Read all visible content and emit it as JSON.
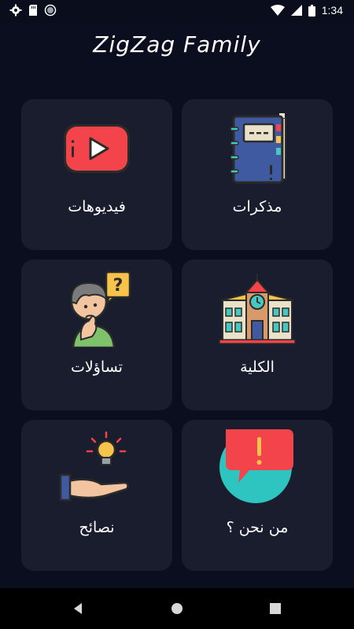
{
  "status_bar": {
    "time": "1:34",
    "left_icons": [
      "gear-icon",
      "sd-card-icon",
      "record-icon"
    ],
    "right_icons": [
      "wifi-icon",
      "signal-icon",
      "battery-icon"
    ]
  },
  "app": {
    "title": "ZigZag Family"
  },
  "cards": [
    {
      "label": "فيديوهات",
      "icon": "youtube-play-icon"
    },
    {
      "label": "مذكرات",
      "icon": "notebook-icon"
    },
    {
      "label": "تساؤلات",
      "icon": "thinking-person-icon"
    },
    {
      "label": "الكلية",
      "icon": "college-building-icon"
    },
    {
      "label": "نصائح",
      "icon": "hand-lightbulb-icon"
    },
    {
      "label": "من نحن ؟",
      "icon": "alert-chat-icon"
    }
  ],
  "nav_bar": {
    "buttons": [
      "back-icon",
      "home-icon",
      "recents-icon"
    ]
  },
  "colors": {
    "background": "#0b0e1f",
    "card": "#1a1d2e",
    "text": "#ffffff"
  }
}
